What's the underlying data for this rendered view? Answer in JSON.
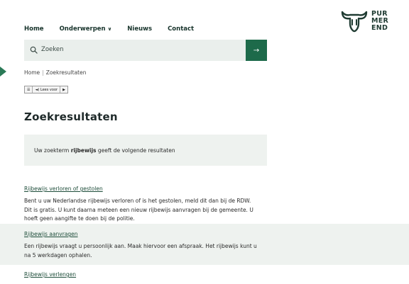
{
  "logo": {
    "lines": [
      "PUR",
      "MER",
      "END"
    ]
  },
  "nav": [
    {
      "label": "Home"
    },
    {
      "label": "Onderwerpen",
      "has_dropdown": true
    },
    {
      "label": "Nieuws"
    },
    {
      "label": "Contact"
    }
  ],
  "search": {
    "value": "Zoeken",
    "button_icon": "arrow-right-icon"
  },
  "breadcrumb": [
    "Home",
    "Zoekresultaten"
  ],
  "readspeaker": {
    "listen_label": "Lees voor"
  },
  "page_title": "Zoekresultaten",
  "summary": {
    "prefix": "Uw zoekterm ",
    "term": "rijbewijs",
    "suffix": " geeft de volgende resultaten"
  },
  "results": [
    {
      "title": "Rijbewijs verloren of gestolen",
      "lines": [
        "Bent u uw Nederlandse rijbewijs verloren of is het gestolen, meld dit dan bij de RDW.",
        "Dit is gratis. U kunt daarna meteen een nieuw rijbewijs aanvragen bij de gemeente. U",
        "hoeft geen aangifte te doen bij de politie."
      ]
    },
    {
      "title": "Rijbewijs aanvragen",
      "lines": [
        "Een rijbewijs vraagt u persoonlijk aan. Maak hiervoor een afspraak. Het rijbewijs kunt u",
        "na 5 werkdagen ophalen."
      ]
    },
    {
      "title": "Rijbewijs verlengen",
      "lines": []
    }
  ],
  "colors": {
    "brand_green": "#1d6a4a",
    "panel_bg": "#eef2ef",
    "link": "#1e4d3a"
  }
}
